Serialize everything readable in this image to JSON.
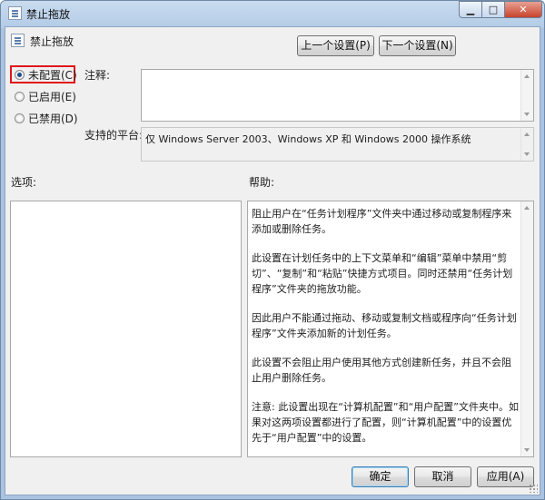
{
  "window": {
    "title": "禁止拖放"
  },
  "header": {
    "policy_name": "禁止拖放",
    "prev_button": "上一个设置(P)",
    "next_button": "下一个设置(N)"
  },
  "options": {
    "not_configured": "未配置(C)",
    "enabled": "已启用(E)",
    "disabled": "已禁用(D)",
    "selected": "not_configured"
  },
  "labels": {
    "comment": "注释:",
    "supported_on": "支持的平台:",
    "options": "选项:",
    "help": "帮助:"
  },
  "supported_text": "仅 Windows Server 2003、Windows XP 和 Windows 2000 操作系统",
  "help_paragraphs": [
    "阻止用户在“任务计划程序”文件夹中通过移动或复制程序来添加或删除任务。",
    "此设置在计划任务中的上下文菜单和“编辑”菜单中禁用“剪切”、“复制”和“粘贴”快捷方式项目。同时还禁用“任务计划程序”文件夹的拖放功能。",
    "因此用户不能通过拖动、移动或复制文档或程序向“任务计划程序”文件夹添加新的计划任务。",
    "此设置不会阻止用户使用其他方式创建新任务，并且不会阻止用户删除任务。",
    "注意: 此设置出现在“计算机配置”和“用户配置”文件夹中。如果对这两项设置都进行了配置，则“计算机配置”中的设置优先于“用户配置”中的设置。"
  ],
  "footer": {
    "ok": "确定",
    "cancel": "取消",
    "apply": "应用(A)"
  },
  "colors": {
    "highlight": "#e0161b",
    "selected_radio": "#1a4f8a"
  }
}
